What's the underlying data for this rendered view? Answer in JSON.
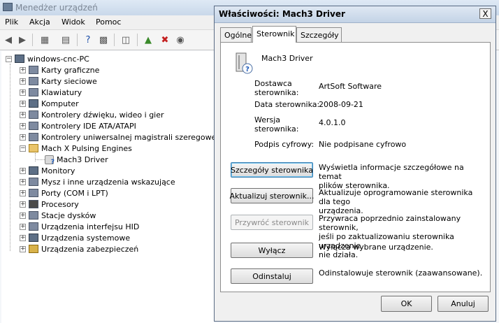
{
  "main_window": {
    "title": "Menedżer urządzeń",
    "menu": [
      "Plik",
      "Akcja",
      "Widok",
      "Pomoc"
    ],
    "tree": {
      "root": "windows-cnc-PC",
      "items": [
        {
          "label": "Karty graficzne",
          "icon": "display-adapter-icon"
        },
        {
          "label": "Karty sieciowe",
          "icon": "network-adapter-icon"
        },
        {
          "label": "Klawiatury",
          "icon": "keyboard-icon"
        },
        {
          "label": "Komputer",
          "icon": "computer-icon"
        },
        {
          "label": "Kontrolery dźwięku, wideo i gier",
          "icon": "sound-icon"
        },
        {
          "label": "Kontrolery IDE ATA/ATAPI",
          "icon": "ide-icon"
        },
        {
          "label": "Kontrolery uniwersalnej magistrali szeregowej",
          "icon": "usb-icon"
        },
        {
          "label": "Mach  X Pulsing Engines",
          "icon": "gear-icon",
          "expanded": true
        },
        {
          "label": "Mach3 Driver",
          "icon": "unknown-device-icon",
          "child": true
        },
        {
          "label": "Monitory",
          "icon": "monitor-icon"
        },
        {
          "label": "Mysz i inne urządzenia wskazujące",
          "icon": "mouse-icon"
        },
        {
          "label": "Porty (COM i LPT)",
          "icon": "port-icon"
        },
        {
          "label": "Procesory",
          "icon": "processor-icon"
        },
        {
          "label": "Stacje dysków",
          "icon": "disk-icon"
        },
        {
          "label": "Urządzenia interfejsu HID",
          "icon": "hid-icon"
        },
        {
          "label": "Urządzenia systemowe",
          "icon": "system-icon"
        },
        {
          "label": "Urządzenia zabezpieczeń",
          "icon": "security-icon"
        }
      ]
    }
  },
  "dialog": {
    "title": "Właściwości: Mach3 Driver",
    "close": "X",
    "tabs": [
      "Ogólne",
      "Sterownik",
      "Szczegóły"
    ],
    "active_tab": "Sterownik",
    "device_name": "Mach3 Driver",
    "fields": {
      "provider_label_1": "Dostawca",
      "provider_label_2": "sterownika:",
      "provider_value": "ArtSoft Software",
      "date_label": "Data sterownika:",
      "date_value": "2008-09-21",
      "version_label_1": "Wersja",
      "version_label_2": "sterownika:",
      "version_value": "4.0.1.0",
      "signer_label": "Podpis cyfrowy:",
      "signer_value": "Nie podpisane cyfrowo"
    },
    "actions": [
      {
        "button": "Szczegóły sterownika",
        "desc": [
          "Wyświetla informacje szczegółowe na temat",
          "plików sterownika."
        ]
      },
      {
        "button": "Aktualizuj sterownik...",
        "desc": [
          "Aktualizuje oprogramowanie sterownika dla tego",
          "urządzenia."
        ]
      },
      {
        "button": "Przywróć sterownik",
        "desc": [
          "Przywraca poprzednio zainstalowany sterownik,",
          "jeśli po zaktualizowaniu sterownika urządzenie",
          "nie działa."
        ],
        "disabled": true
      },
      {
        "button": "Wyłącz",
        "desc": [
          "Wyłącza wybrane urządzenie."
        ]
      },
      {
        "button": "Odinstaluj",
        "desc": [
          "Odinstalowuje sterownik (zaawansowane)."
        ]
      }
    ],
    "ok": "OK",
    "cancel": "Anuluj"
  }
}
